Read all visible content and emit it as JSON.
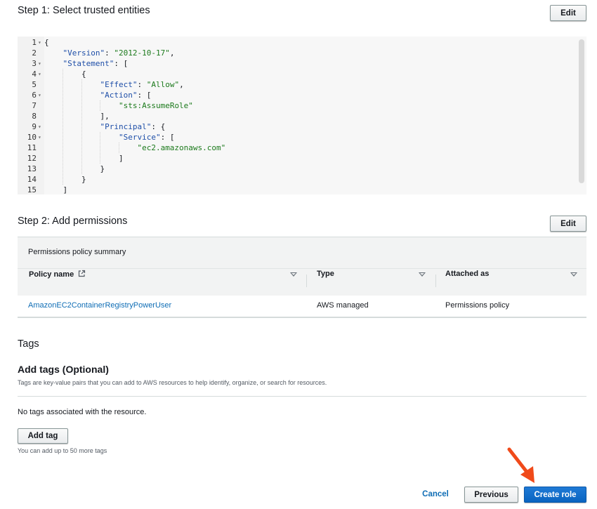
{
  "step1": {
    "title": "Step 1: Select trusted entities",
    "edit_label": "Edit"
  },
  "code": {
    "lines": [
      {
        "n": "1",
        "fold": "▾"
      },
      {
        "n": "2",
        "fold": ""
      },
      {
        "n": "3",
        "fold": "▾"
      },
      {
        "n": "4",
        "fold": "▾"
      },
      {
        "n": "5",
        "fold": ""
      },
      {
        "n": "6",
        "fold": "▾"
      },
      {
        "n": "7",
        "fold": ""
      },
      {
        "n": "8",
        "fold": ""
      },
      {
        "n": "9",
        "fold": "▾"
      },
      {
        "n": "10",
        "fold": "▾"
      },
      {
        "n": "11",
        "fold": ""
      },
      {
        "n": "12",
        "fold": ""
      },
      {
        "n": "13",
        "fold": ""
      },
      {
        "n": "14",
        "fold": ""
      },
      {
        "n": "15",
        "fold": ""
      }
    ],
    "text": [
      "{",
      "    \"Version\": \"2012-10-17\",",
      "    \"Statement\": [",
      "        {",
      "            \"Effect\": \"Allow\",",
      "            \"Action\": [",
      "                \"sts:AssumeRole\"",
      "            ],",
      "            \"Principal\": {",
      "                \"Service\": [",
      "                    \"ec2.amazonaws.com\"",
      "                ]",
      "            }",
      "        }",
      "    ]"
    ]
  },
  "step2": {
    "title": "Step 2: Add permissions",
    "edit_label": "Edit",
    "summary_title": "Permissions policy summary",
    "columns": [
      "Policy name",
      "Type",
      "Attached as"
    ],
    "rows": [
      {
        "policy_name": "AmazonEC2ContainerRegistryPowerUser",
        "type": "AWS managed",
        "attached_as": "Permissions policy"
      }
    ]
  },
  "tags": {
    "section_title": "Tags",
    "heading": "Add tags (Optional)",
    "description": "Tags are key-value pairs that you can add to AWS resources to help identify, organize, or search for resources.",
    "empty_text": "No tags associated with the resource.",
    "add_tag_label": "Add tag",
    "limit_text": "You can add up to 50 more tags"
  },
  "footer": {
    "cancel_label": "Cancel",
    "previous_label": "Previous",
    "create_label": "Create role"
  },
  "colors": {
    "primary": "#0a64c1",
    "link": "#0f6db5",
    "annotation_arrow": "#f04a1a"
  },
  "icons": {
    "external_link": "external-link-icon",
    "sort": "sort-caret-icon"
  }
}
